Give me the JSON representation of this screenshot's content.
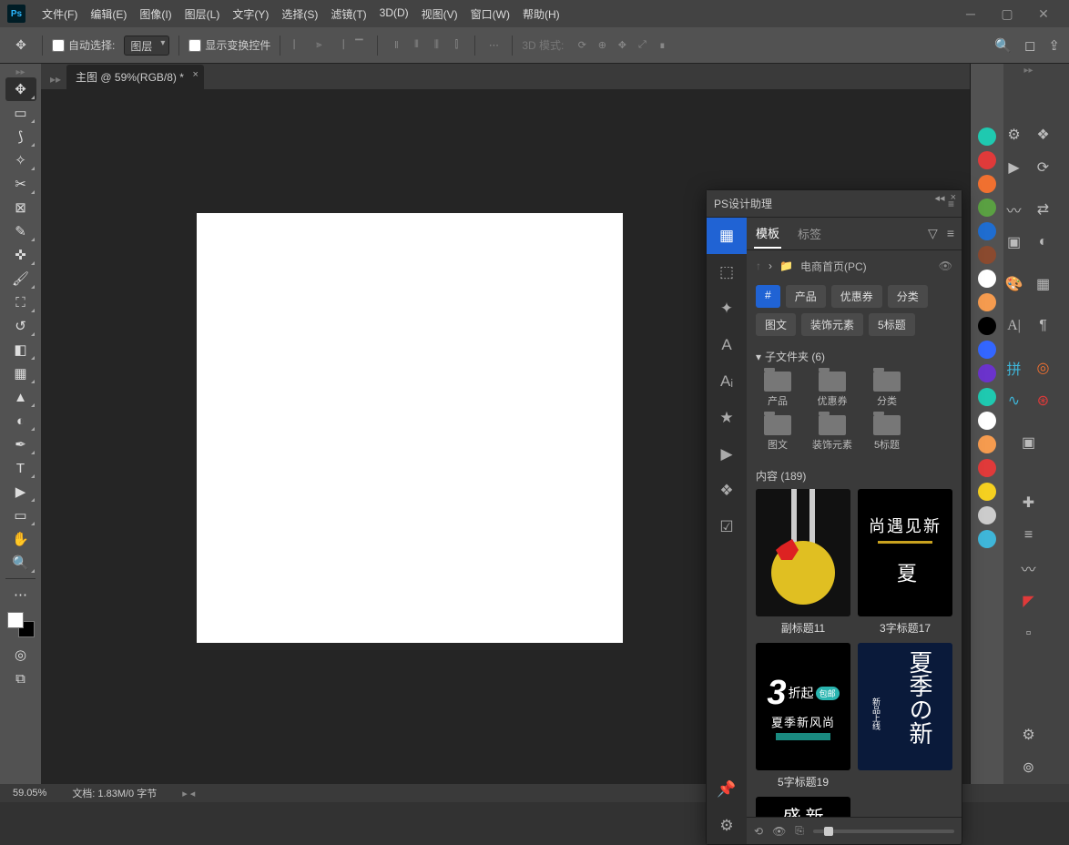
{
  "app": {
    "logo": "Ps"
  },
  "menubar": [
    "文件(F)",
    "编辑(E)",
    "图像(I)",
    "图层(L)",
    "文字(Y)",
    "选择(S)",
    "滤镜(T)",
    "3D(D)",
    "视图(V)",
    "窗口(W)",
    "帮助(H)"
  ],
  "options": {
    "autoSelectLabel": "自动选择:",
    "layerDropdown": "图层",
    "showTransformLabel": "显示变换控件",
    "mode3DLabel": "3D 模式:"
  },
  "docTab": "主图 @ 59%(RGB/8) *",
  "panel": {
    "title": "PS设计助理",
    "tabs": {
      "template": "模板",
      "tags": "标签"
    },
    "breadcrumb": "电商首页(PC)",
    "tags": [
      "#",
      "产品",
      "优惠券",
      "分类",
      "图文",
      "装饰元素",
      "5标题"
    ],
    "subfolderHead": "子文件夹 (6)",
    "folders": [
      "产品",
      "优惠券",
      "分类",
      "图文",
      "装饰元素",
      "5标题"
    ],
    "contentHead": "内容 (189)",
    "thumbs": [
      {
        "label": "副标题11"
      },
      {
        "label": "3字标题17",
        "line1": "夏",
        "line2": "尚遇见新"
      },
      {
        "label": "5字标题19",
        "big": "3",
        "sub": "折起",
        "line": "夏季新风尚",
        "badge": "包邮"
      },
      {
        "label": "",
        "vtext": "夏季の新",
        "side": "新品上线"
      },
      {
        "label": "",
        "t": "盛 新"
      }
    ]
  },
  "status": {
    "zoom": "59.05%",
    "doc": "文档: 1.83M/0 字节"
  },
  "swatches": [
    "#1fc9b0",
    "#e03a3a",
    "#f07030",
    "#5aa042",
    "#1f6dd0",
    "#8a4a2f",
    "#ffffff",
    "#f59b4f",
    "#000000",
    "#3366ff",
    "#6b33cc",
    "#1fc9b0",
    "#ffffff",
    "#f59b4f",
    "#e03a3a",
    "#f5d020",
    "#cccccc",
    "#3fb6d9"
  ]
}
